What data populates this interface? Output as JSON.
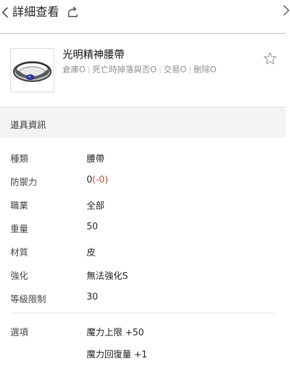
{
  "header": {
    "title": "詳細查看"
  },
  "item": {
    "name": "光明精神腰帶",
    "flags": [
      "倉庫O",
      "死亡時掉落與否O",
      "交易O",
      "刪除O"
    ],
    "icon": "ring-belt-icon"
  },
  "section": {
    "title": "道具資訊"
  },
  "info": {
    "type": {
      "label": "種類",
      "value": "腰帶"
    },
    "defense": {
      "label": "防禦力",
      "value": "0",
      "modifier": "(-0)"
    },
    "job": {
      "label": "職業",
      "value": "全部"
    },
    "weight": {
      "label": "重量",
      "value": "50"
    },
    "material": {
      "label": "材質",
      "value": "皮"
    },
    "enhance": {
      "label": "強化",
      "value": "無法強化S"
    },
    "level": {
      "label": "等級限制",
      "value": "30"
    }
  },
  "options": {
    "label": "選項",
    "values": [
      "魔力上限 +50",
      "魔力回復量 +1"
    ]
  },
  "colors": {
    "negative": "#c0462e",
    "section_bg": "#f3f3f3"
  }
}
